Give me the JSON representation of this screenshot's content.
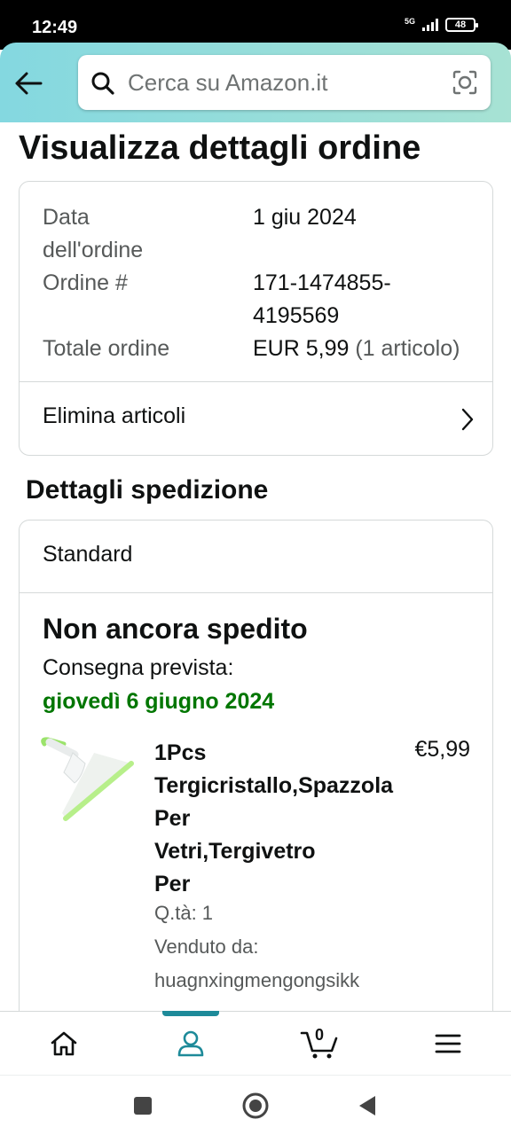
{
  "status_bar": {
    "time": "12:49",
    "network": "5G",
    "battery": "48"
  },
  "header": {
    "search_placeholder": "Cerca su Amazon.it",
    "back_icon": "back-arrow-icon",
    "search_icon": "search-icon",
    "camera_icon": "camera-lens-icon"
  },
  "page": {
    "title": "Visualizza dettagli ordine"
  },
  "order": {
    "date_label_line1": "Data",
    "date_label_line2": "dell'ordine",
    "date_value": "1 giu 2024",
    "number_label": "Ordine #",
    "number_value_line1": "171-1474855-",
    "number_value_line2": "4195569",
    "total_label": "Totale ordine",
    "total_value": "EUR 5,99",
    "total_items": "(1 articolo)",
    "action_label": "Elimina articoli"
  },
  "shipping": {
    "section_title": "Dettagli spedizione",
    "method": "Standard",
    "status": "Non ancora spedito",
    "delivery_label": "Consegna prevista:",
    "delivery_date": "giovedì 6 giugno 2024",
    "product": {
      "title_lines": [
        "1Pcs",
        "Tergicristallo,Spazzola",
        "Per",
        "Vetri,Tergivetro",
        "Per"
      ],
      "price": "€5,99",
      "qty": "Q.tà: 1",
      "seller_label": "Venduto da:",
      "seller": "huagnxingmengongsikk"
    }
  },
  "bottom_nav": {
    "items": [
      "home-icon",
      "account-icon",
      "cart-icon",
      "menu-icon"
    ],
    "active": "account-icon",
    "cart_count": "0"
  },
  "colors": {
    "header_gradient_start": "#84d8e0",
    "header_gradient_end": "#a7e2d4",
    "delivery_green": "#007600",
    "active_tab": "#1d8a99"
  }
}
